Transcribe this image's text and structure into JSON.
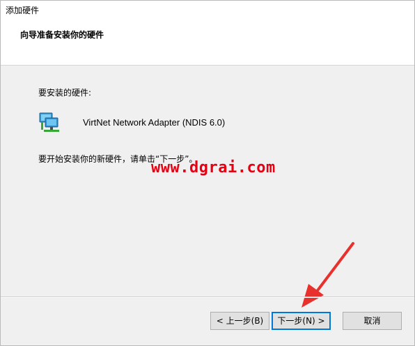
{
  "window": {
    "title": "添加硬件"
  },
  "wizard": {
    "heading": "向导准备安装你的硬件",
    "hardware_label": "要安装的硬件:",
    "device": {
      "name": "VirtNet Network Adapter (NDIS 6.0)",
      "icon": "network-adapter-icon"
    },
    "instruction": "要开始安装你的新硬件，请单击“下一步”。"
  },
  "watermark": {
    "text": "www.dgrai.com",
    "color": "#e60012"
  },
  "buttons": {
    "back": "< 上一步(B)",
    "next": "下一步(N) >",
    "cancel": "取消"
  },
  "colors": {
    "accent": "#0078d7",
    "annotation_arrow": "#e8302c"
  }
}
